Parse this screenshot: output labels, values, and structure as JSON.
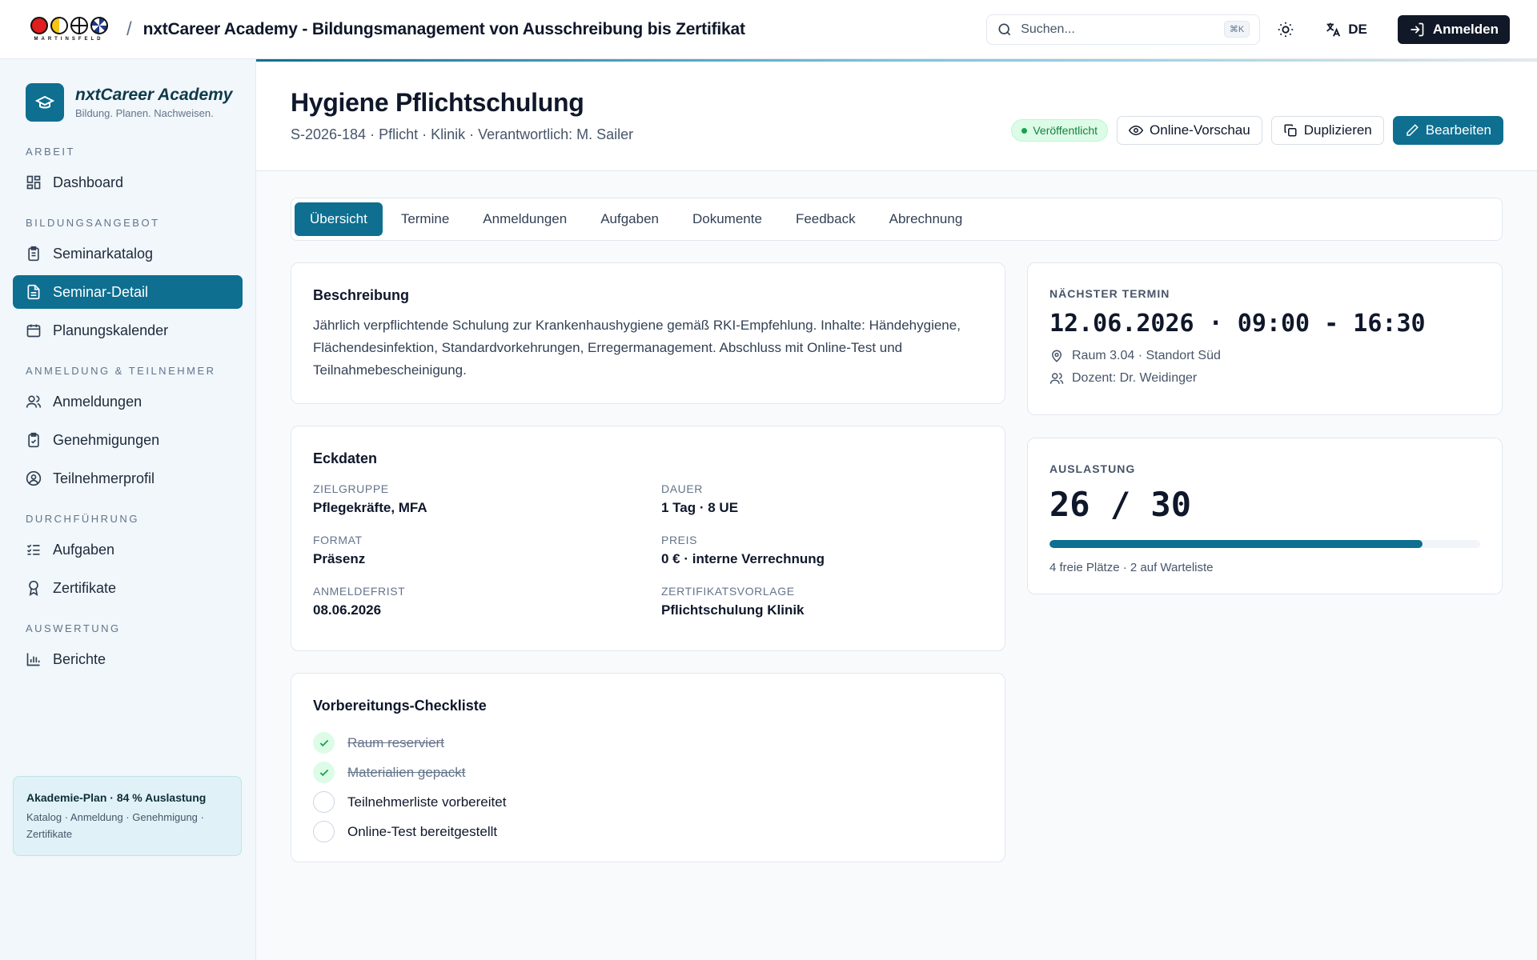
{
  "topbar": {
    "logo_text": "MARTINSFELD",
    "separator": "/",
    "app_title": "nxtCareer Academy - Bildungsmanagement von Ausschreibung bis Zertifikat",
    "search_placeholder": "Suchen...",
    "search_shortcut": "⌘K",
    "language": "DE",
    "login_label": "Anmelden"
  },
  "sidebar": {
    "brand_name": "nxtCareer Academy",
    "brand_tagline": "Bildung. Planen. Nachweisen.",
    "sections": [
      {
        "title": "ARBEIT",
        "items": [
          {
            "label": "Dashboard",
            "icon": "dashboard-icon"
          }
        ]
      },
      {
        "title": "BILDUNGSANGEBOT",
        "items": [
          {
            "label": "Seminarkatalog",
            "icon": "clipboard-icon"
          },
          {
            "label": "Seminar-Detail",
            "icon": "document-icon",
            "active": true
          },
          {
            "label": "Planungskalender",
            "icon": "calendar-icon"
          }
        ]
      },
      {
        "title": "ANMELDUNG & TEILNEHMER",
        "items": [
          {
            "label": "Anmeldungen",
            "icon": "users-icon"
          },
          {
            "label": "Genehmigungen",
            "icon": "clipboard-check-icon"
          },
          {
            "label": "Teilnehmerprofil",
            "icon": "user-circle-icon"
          }
        ]
      },
      {
        "title": "DURCHFÜHRUNG",
        "items": [
          {
            "label": "Aufgaben",
            "icon": "tasks-icon"
          },
          {
            "label": "Zertifikate",
            "icon": "award-icon"
          }
        ]
      },
      {
        "title": "AUSWERTUNG",
        "items": [
          {
            "label": "Berichte",
            "icon": "bar-chart-icon"
          }
        ]
      }
    ],
    "plan_box": {
      "title": "Akademie-Plan · 84 % Auslastung",
      "subtitle": "Katalog · Anmeldung · Genehmigung · Zertifikate"
    }
  },
  "header": {
    "title": "Hygiene Pflichtschulung",
    "subtitle": "S-2026-184 · Pflicht · Klinik · Verantwortlich: M. Sailer",
    "status_badge": "Veröffentlicht",
    "preview_label": "Online-Vorschau",
    "duplicate_label": "Duplizieren",
    "edit_label": "Bearbeiten"
  },
  "tabs": [
    {
      "label": "Übersicht",
      "active": true
    },
    {
      "label": "Termine"
    },
    {
      "label": "Anmeldungen"
    },
    {
      "label": "Aufgaben"
    },
    {
      "label": "Dokumente"
    },
    {
      "label": "Feedback"
    },
    {
      "label": "Abrechnung"
    }
  ],
  "description": {
    "title": "Beschreibung",
    "text": "Jährlich verpflichtende Schulung zur Krankenhaushygiene gemäß RKI-Empfehlung. Inhalte: Händehygiene, Flächendesinfektion, Standardvorkehrungen, Erregermanagement. Abschluss mit Online-Test und Teilnahmebescheinigung."
  },
  "eckdaten": {
    "title": "Eckdaten",
    "facts": [
      {
        "label": "ZIELGRUPPE",
        "value": "Pflegekräfte, MFA"
      },
      {
        "label": "DAUER",
        "value": "1 Tag · 8 UE"
      },
      {
        "label": "FORMAT",
        "value": "Präsenz"
      },
      {
        "label": "PREIS",
        "value": "0 € · interne Verrechnung"
      },
      {
        "label": "ANMELDEFRIST",
        "value": "08.06.2026"
      },
      {
        "label": "ZERTIFIKATSVORLAGE",
        "value": "Pflichtschulung Klinik"
      }
    ]
  },
  "checklist": {
    "title": "Vorbereitungs-Checkliste",
    "items": [
      {
        "label": "Raum reserviert",
        "done": true
      },
      {
        "label": "Materialien gepackt",
        "done": true
      },
      {
        "label": "Teilnehmerliste vorbereitet",
        "done": false
      },
      {
        "label": "Online-Test bereitgestellt",
        "done": false
      }
    ]
  },
  "next_date": {
    "label": "NÄCHSTER TERMIN",
    "value": "12.06.2026 · 09:00 - 16:30",
    "location": "Raum 3.04 · Standort Süd",
    "lecturer": "Dozent: Dr. Weidinger"
  },
  "utilization": {
    "label": "AUSLASTUNG",
    "value": "26 / 30",
    "fraction": 0.867,
    "note": "4 freie Plätze · 2 auf Warteliste"
  },
  "colors": {
    "accent": "#0e6f91",
    "success": "#16a34a",
    "logo": [
      "#e11d1d",
      "#f5c518",
      "#ffffff",
      "#1e3a8a"
    ]
  }
}
